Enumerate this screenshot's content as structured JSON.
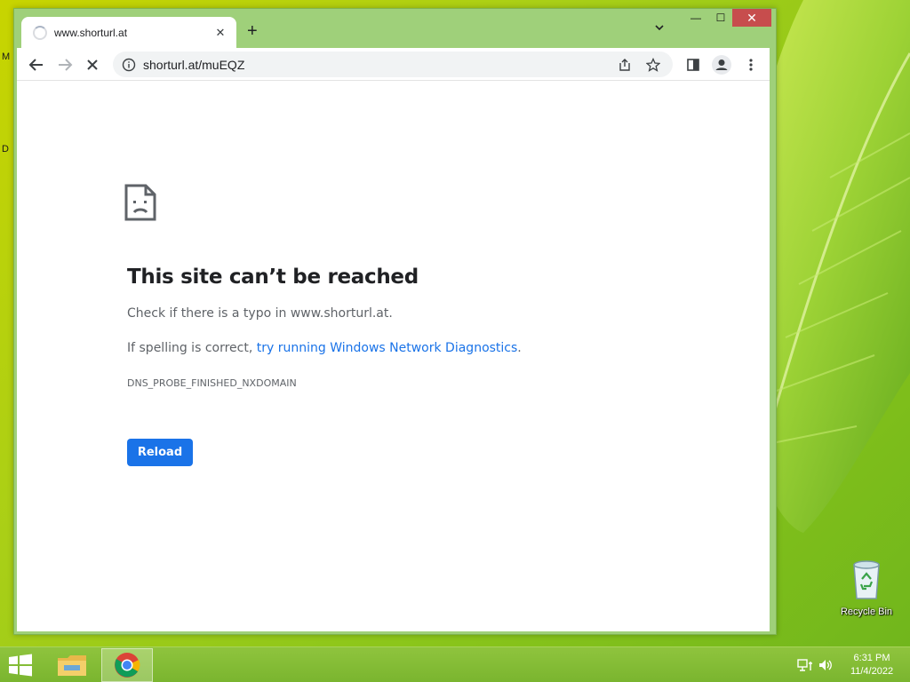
{
  "desktop": {
    "edge_chars": [
      "M",
      "D"
    ],
    "recycle_bin_label": "Recycle Bin"
  },
  "browser": {
    "tab": {
      "title": "www.shorturl.at"
    },
    "new_tab_symbol": "+",
    "window_controls": {
      "minimize": "—",
      "maximize": "☐",
      "close": "✕"
    },
    "omnibox": {
      "url": "shorturl.at/muEQZ"
    },
    "icons": [
      "back-icon",
      "forward-icon",
      "stop-icon",
      "info-icon",
      "share-icon",
      "star-icon",
      "side-panel-icon",
      "profile-icon",
      "menu-icon"
    ]
  },
  "error_page": {
    "title": "This site can’t be reached",
    "line1": "Check if there is a typo in www.shorturl.at.",
    "line2_prefix": "If spelling is correct, ",
    "line2_link": "try running Windows Network Diagnostics",
    "line2_suffix": ".",
    "error_code": "DNS_PROBE_FINISHED_NXDOMAIN",
    "reload_label": "Reload",
    "colors": {
      "link": "#1a73e8",
      "button": "#1a73e8"
    }
  },
  "taskbar": {
    "time": "6:31 PM",
    "date": "11/4/2022",
    "apps": [
      "file-explorer",
      "chrome"
    ]
  }
}
